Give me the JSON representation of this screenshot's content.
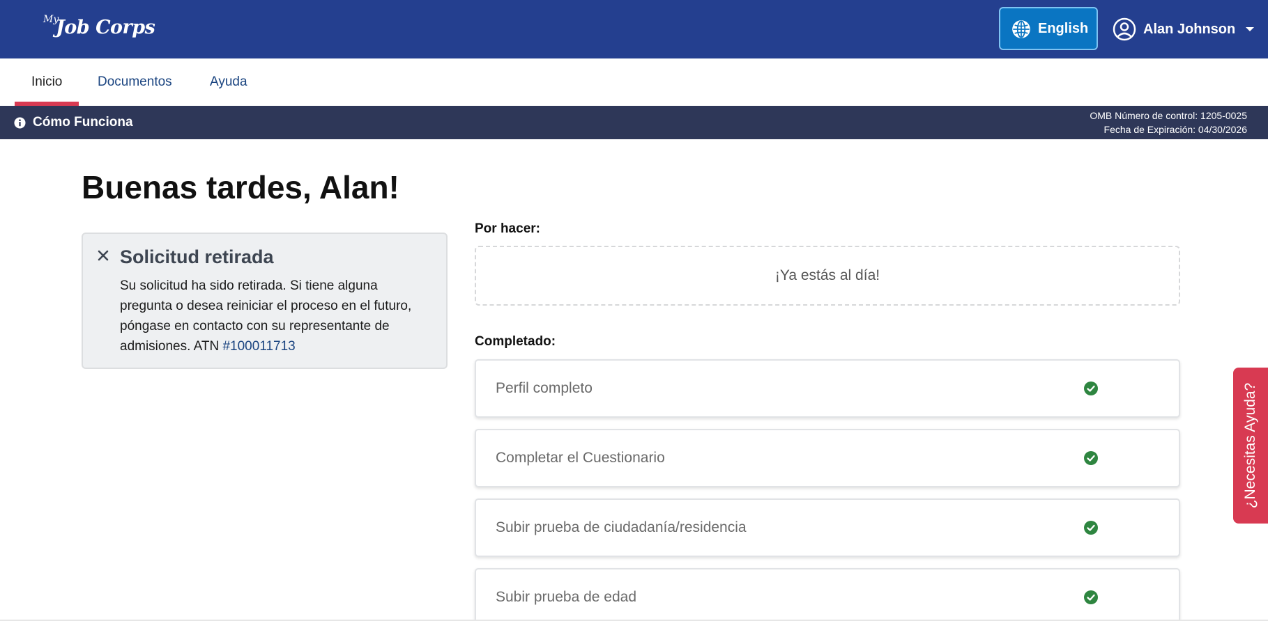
{
  "header": {
    "logo_prefix": "My",
    "logo_name": "Job Corps",
    "language_button": "English",
    "user_name": "Alan Johnson"
  },
  "nav": {
    "items": [
      {
        "label": "Inicio",
        "active": true
      },
      {
        "label": "Documentos",
        "active": false
      },
      {
        "label": "Ayuda",
        "active": false
      }
    ]
  },
  "infobar": {
    "how_it_works": "Cómo Funciona",
    "omb_control": "OMB Número de control: 1205-0025",
    "expiration": "Fecha de Expiración: 04/30/2026"
  },
  "main": {
    "greeting": "Buenas tardes, Alan!",
    "alert": {
      "title": "Solicitud retirada",
      "body": "Su solicitud ha sido retirada. Si tiene alguna pregunta o desea reiniciar el proceso en el futuro, póngase en contacto con su representante de admisiones. ATN ",
      "link": "#100011713"
    },
    "todo_label": "Por hacer:",
    "todo_empty": "¡Ya estás al día!",
    "completed_label": "Completado:",
    "completed_items": [
      {
        "label": "Perfil completo",
        "status": "complete"
      },
      {
        "label": "Completar el Cuestionario",
        "status": "complete"
      },
      {
        "label": "Subir prueba de ciudadanía/residencia",
        "status": "complete"
      },
      {
        "label": "Subir prueba de edad",
        "status": "complete"
      }
    ]
  },
  "help_tab": "¿Necesitas Ayuda?",
  "colors": {
    "header": "#243f8f",
    "infobar": "#2e3758",
    "accent_red": "#d83a52",
    "language_button": "#0a75c2",
    "check_green": "#2e8540",
    "link": "#1a4480"
  },
  "icons": {
    "language": "globe-icon",
    "user": "user-circle-icon",
    "dropdown": "caret-down-icon",
    "info": "info-icon",
    "dismiss": "close-icon",
    "status": "check-circle-icon"
  }
}
